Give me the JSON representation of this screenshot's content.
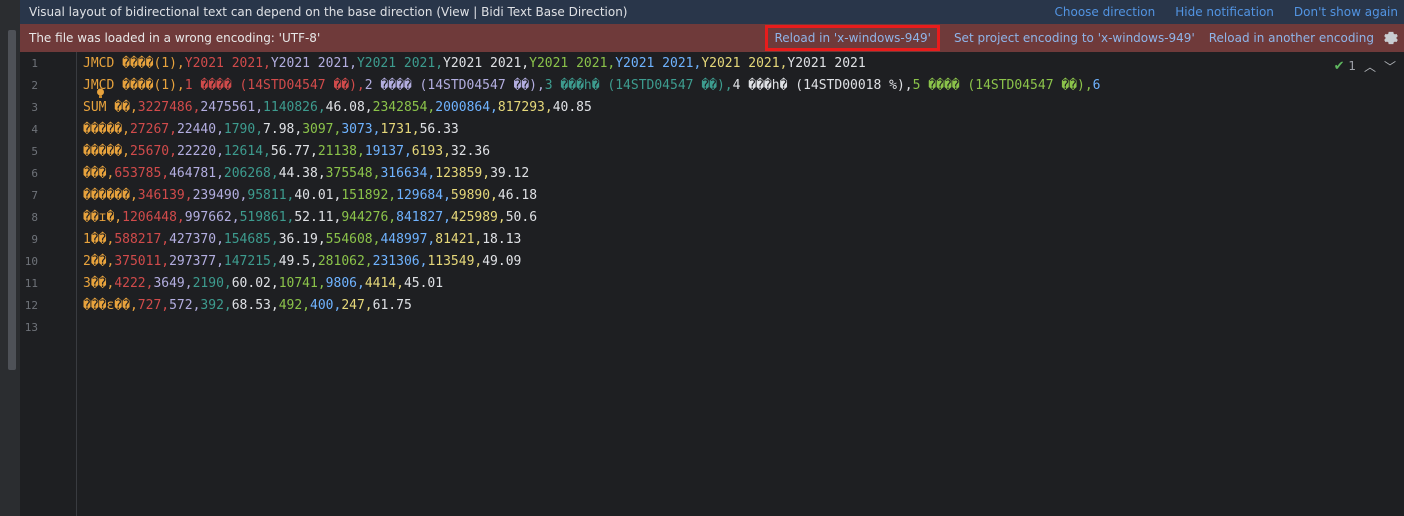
{
  "bidi_banner": {
    "message": "Visual layout of bidirectional text can depend on the base direction (View | Bidi Text Base Direction)",
    "choose_direction": "Choose direction",
    "hide_notification": "Hide notification",
    "dont_show_again": "Don't show again"
  },
  "encoding_banner": {
    "message": "The file was loaded in a wrong encoding: 'UTF-8'",
    "reload_in": "Reload in 'x-windows-949'",
    "set_project_encoding": "Set project encoding to 'x-windows-949'",
    "reload_another": "Reload in another encoding"
  },
  "status_widget": {
    "problems_count": "1"
  },
  "colors": {
    "c0": "#bcbec4",
    "c1": "#cf8e6d",
    "c2": "#c77dbb",
    "c3": "#2aacb8",
    "c4": "#bcbec4",
    "c5": "#6aab73",
    "c6": "#56a8f5",
    "c7": "#e8c46b",
    "c8": "#dfe1e5",
    "red": "#d14b4b",
    "lavender": "#b3aee0",
    "teal": "#3d9c8f",
    "white": "#dfe1e5",
    "green": "#8bc34a",
    "blue": "#6fb3ff",
    "yellow": "#e6d87a",
    "orange": "#e8a33d"
  },
  "editor": {
    "lines": [
      {
        "num": "1",
        "tokens": [
          [
            "JMCD ����(1),",
            "orange"
          ],
          [
            "Y2021 2021,",
            "red"
          ],
          [
            "Y2021 2021,",
            "lavender"
          ],
          [
            "Y2021 2021,",
            "teal"
          ],
          [
            "Y2021 2021,",
            "white"
          ],
          [
            "Y2021 2021,",
            "green"
          ],
          [
            "Y2021 2021,",
            "blue"
          ],
          [
            "Y2021 2021,",
            "yellow"
          ],
          [
            "Y2021 2021",
            "white"
          ]
        ]
      },
      {
        "num": "2",
        "tokens": [
          [
            "JMCD ����(1),",
            "orange"
          ],
          [
            "1 ���� (14STD04547 ��),",
            "red"
          ],
          [
            "2 ���� (14STD04547 ��),",
            "lavender"
          ],
          [
            "3 ���h� (14STD04547 ��),",
            "teal"
          ],
          [
            "4 ���h� (14STD00018 %),",
            "white"
          ],
          [
            "5 ���� (14STD04547 ��),",
            "green"
          ],
          [
            "6",
            "blue"
          ]
        ]
      },
      {
        "num": "3",
        "tokens": [
          [
            "SUM ��,",
            "orange"
          ],
          [
            "3227486,",
            "red"
          ],
          [
            "2475561,",
            "lavender"
          ],
          [
            "1140826,",
            "teal"
          ],
          [
            "46.08,",
            "white"
          ],
          [
            "2342854,",
            "green"
          ],
          [
            "2000864,",
            "blue"
          ],
          [
            "817293,",
            "yellow"
          ],
          [
            "40.85",
            "white"
          ]
        ]
      },
      {
        "num": "4",
        "tokens": [
          [
            "�����,",
            "orange"
          ],
          [
            "27267,",
            "red"
          ],
          [
            "22440,",
            "lavender"
          ],
          [
            "1790,",
            "teal"
          ],
          [
            "7.98,",
            "white"
          ],
          [
            "3097,",
            "green"
          ],
          [
            "3073,",
            "blue"
          ],
          [
            "1731,",
            "yellow"
          ],
          [
            "56.33",
            "white"
          ]
        ]
      },
      {
        "num": "5",
        "tokens": [
          [
            "�����,",
            "orange"
          ],
          [
            "25670,",
            "red"
          ],
          [
            "22220,",
            "lavender"
          ],
          [
            "12614,",
            "teal"
          ],
          [
            "56.77,",
            "white"
          ],
          [
            "21138,",
            "green"
          ],
          [
            "19137,",
            "blue"
          ],
          [
            "6193,",
            "yellow"
          ],
          [
            "32.36",
            "white"
          ]
        ]
      },
      {
        "num": "6",
        "tokens": [
          [
            "���,",
            "orange"
          ],
          [
            "653785,",
            "red"
          ],
          [
            "464781,",
            "lavender"
          ],
          [
            "206268,",
            "teal"
          ],
          [
            "44.38,",
            "white"
          ],
          [
            "375548,",
            "green"
          ],
          [
            "316634,",
            "blue"
          ],
          [
            "123859,",
            "yellow"
          ],
          [
            "39.12",
            "white"
          ]
        ]
      },
      {
        "num": "7",
        "tokens": [
          [
            "������,",
            "orange"
          ],
          [
            "346139,",
            "red"
          ],
          [
            "239490,",
            "lavender"
          ],
          [
            "95811,",
            "teal"
          ],
          [
            "40.01,",
            "white"
          ],
          [
            "151892,",
            "green"
          ],
          [
            "129684,",
            "blue"
          ],
          [
            "59890,",
            "yellow"
          ],
          [
            "46.18",
            "white"
          ]
        ]
      },
      {
        "num": "8",
        "tokens": [
          [
            "��ɪ�,",
            "orange"
          ],
          [
            "1206448,",
            "red"
          ],
          [
            "997662,",
            "lavender"
          ],
          [
            "519861,",
            "teal"
          ],
          [
            "52.11,",
            "white"
          ],
          [
            "944276,",
            "green"
          ],
          [
            "841827,",
            "blue"
          ],
          [
            "425989,",
            "yellow"
          ],
          [
            "50.6",
            "white"
          ]
        ]
      },
      {
        "num": "9",
        "tokens": [
          [
            "1��,",
            "orange"
          ],
          [
            "588217,",
            "red"
          ],
          [
            "427370,",
            "lavender"
          ],
          [
            "154685,",
            "teal"
          ],
          [
            "36.19,",
            "white"
          ],
          [
            "554608,",
            "green"
          ],
          [
            "448997,",
            "blue"
          ],
          [
            "81421,",
            "yellow"
          ],
          [
            "18.13",
            "white"
          ]
        ]
      },
      {
        "num": "10",
        "tokens": [
          [
            "2��,",
            "orange"
          ],
          [
            "375011,",
            "red"
          ],
          [
            "297377,",
            "lavender"
          ],
          [
            "147215,",
            "teal"
          ],
          [
            "49.5,",
            "white"
          ],
          [
            "281062,",
            "green"
          ],
          [
            "231306,",
            "blue"
          ],
          [
            "113549,",
            "yellow"
          ],
          [
            "49.09",
            "white"
          ]
        ]
      },
      {
        "num": "11",
        "tokens": [
          [
            "3��,",
            "orange"
          ],
          [
            "4222,",
            "red"
          ],
          [
            "3649,",
            "lavender"
          ],
          [
            "2190,",
            "teal"
          ],
          [
            "60.02,",
            "white"
          ],
          [
            "10741,",
            "green"
          ],
          [
            "9806,",
            "blue"
          ],
          [
            "4414,",
            "yellow"
          ],
          [
            "45.01",
            "white"
          ]
        ]
      },
      {
        "num": "12",
        "tokens": [
          [
            "���ε��,",
            "orange"
          ],
          [
            "727,",
            "red"
          ],
          [
            "572,",
            "lavender"
          ],
          [
            "392,",
            "teal"
          ],
          [
            "68.53,",
            "white"
          ],
          [
            "492,",
            "green"
          ],
          [
            "400,",
            "blue"
          ],
          [
            "247,",
            "yellow"
          ],
          [
            "61.75",
            "white"
          ]
        ]
      },
      {
        "num": "13",
        "tokens": []
      }
    ]
  }
}
